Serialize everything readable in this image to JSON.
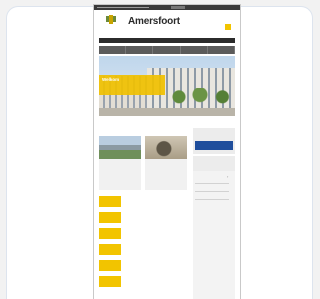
{
  "site": {
    "title": "Amersfoort",
    "topbar_text": "",
    "topbar_button": "",
    "header_small_text": "",
    "subbar_text": "",
    "logo_text": ""
  },
  "nav": {
    "items": [
      {
        "label": ""
      },
      {
        "label": ""
      },
      {
        "label": ""
      },
      {
        "label": ""
      },
      {
        "label": ""
      }
    ]
  },
  "hero": {
    "title": "Welkom",
    "text": ""
  },
  "news": {
    "section_label": "",
    "items": [
      {
        "title": "",
        "text": ""
      },
      {
        "title": "",
        "text": ""
      }
    ]
  },
  "sidebar": {
    "box1_label": "",
    "box1_button": "",
    "box2_title": "",
    "box3_title": "",
    "box3_icon": "arrow-icon"
  },
  "events": [
    {
      "date": "",
      "title": "",
      "sub": ""
    },
    {
      "date": "",
      "title": "",
      "sub": ""
    },
    {
      "date": "",
      "title": "",
      "sub": ""
    },
    {
      "date": "",
      "title": "",
      "sub": ""
    },
    {
      "date": "",
      "title": "",
      "sub": ""
    },
    {
      "date": "",
      "title": "",
      "sub": ""
    }
  ],
  "colors": {
    "accent_yellow": "#f2c400",
    "dark_bar": "#2b2b2b",
    "nav_grey": "#5b5b5b",
    "button_blue": "#1f4e9c"
  }
}
